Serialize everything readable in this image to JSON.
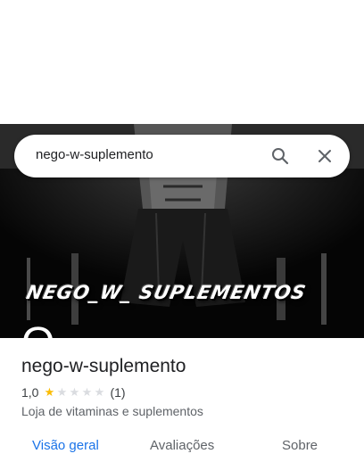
{
  "search": {
    "query": "nego-w-suplemento",
    "icons": {
      "search": "search-icon",
      "close": "close-icon"
    }
  },
  "hero": {
    "brand_text": "NEGO_W_ SUPLEMENTOS",
    "partial_text": "O"
  },
  "place": {
    "name": "nego-w-suplemento",
    "rating": "1,0",
    "stars_filled": 1,
    "stars_total": 5,
    "review_count": "(1)",
    "category": "Loja de vitaminas e suplementos"
  },
  "tabs": [
    {
      "label": "Visão geral",
      "active": true
    },
    {
      "label": "Avaliações",
      "active": false
    },
    {
      "label": "Sobre",
      "active": false
    }
  ],
  "colors": {
    "accent": "#1a73e8",
    "star": "#fbbc04",
    "star_empty": "#dadce0",
    "text": "#202124",
    "secondary_text": "#5f6368"
  }
}
